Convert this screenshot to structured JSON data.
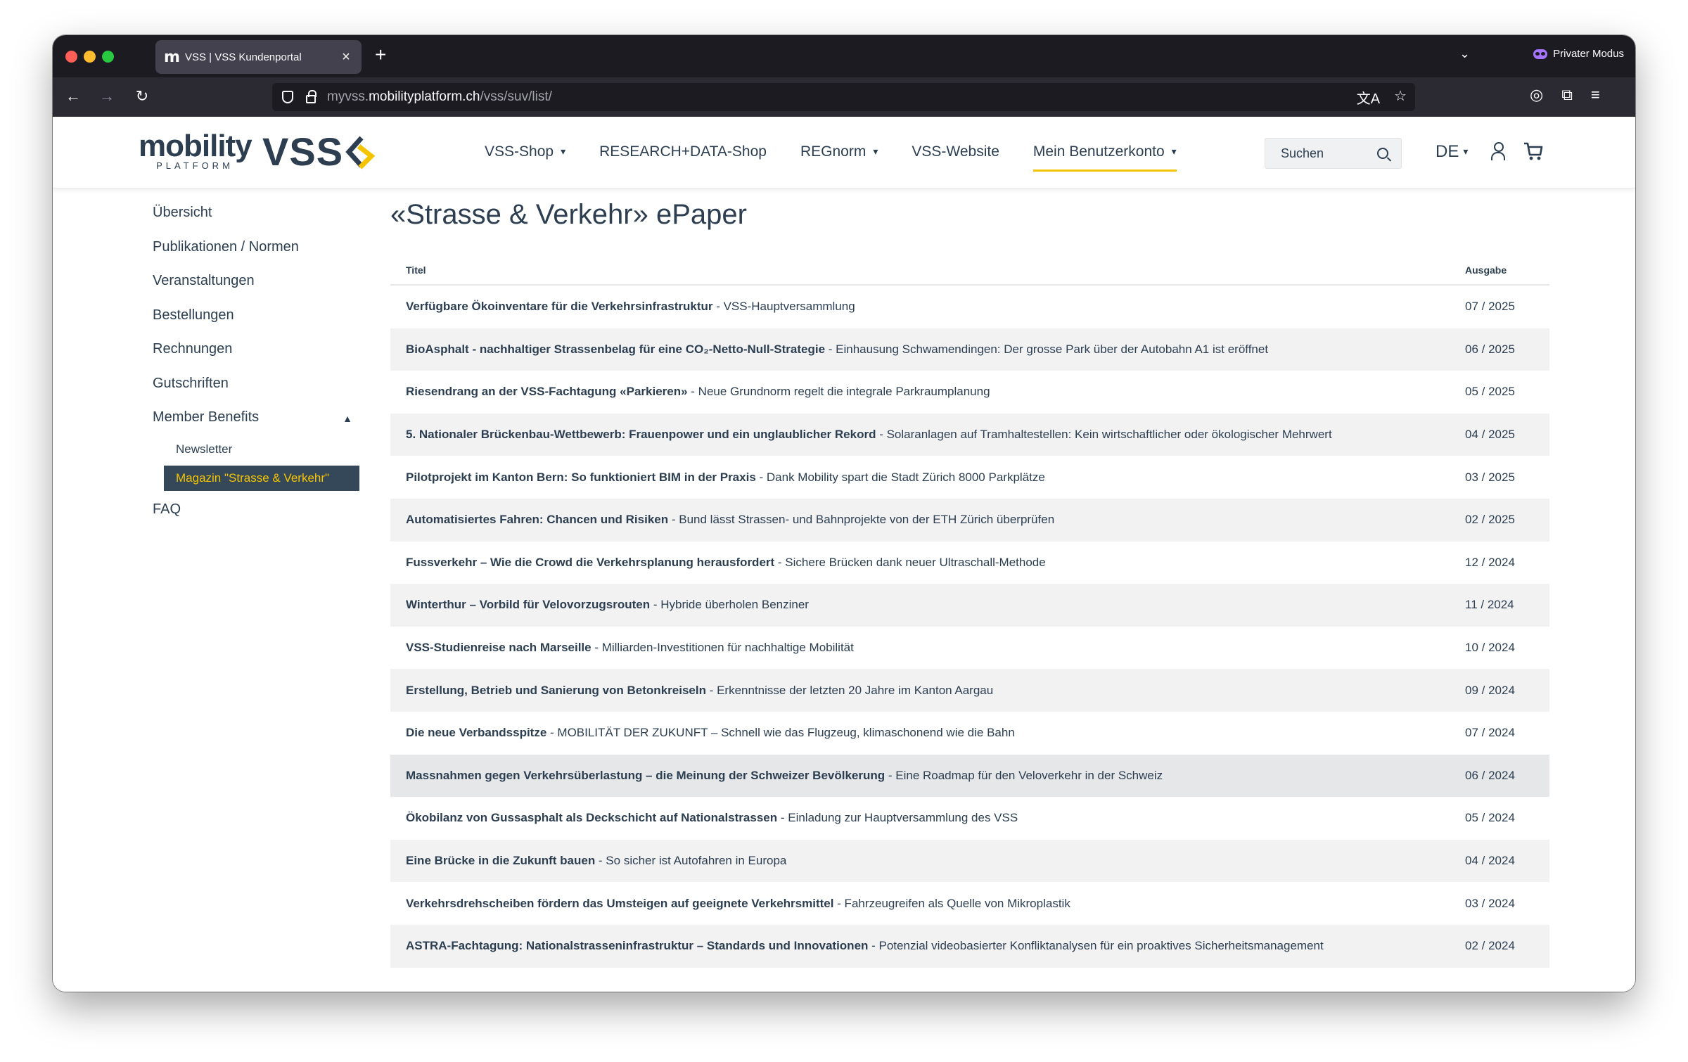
{
  "browser": {
    "tab_favicon": "m",
    "tab_title": "VSS | VSS Kundenportal",
    "tab_close": "×",
    "new_tab": "+",
    "tab_list": "⌄",
    "private_label": "Privater Modus",
    "back": "←",
    "forward": "→",
    "reload": "↻",
    "url_prefix": "myvss.",
    "url_host": "mobilityplatform.ch",
    "url_path": "/vss/suv/list/",
    "translate_icon": "文A",
    "bookmark_icon": "☆",
    "toolbar_icons": [
      "◎",
      "⧉",
      "≡"
    ]
  },
  "header": {
    "logo_mobility_word": "mobility",
    "logo_mobility_sub": "PLATFORM",
    "logo_vss_word": "VSS",
    "nav": [
      {
        "label": "VSS-Shop",
        "dropdown": true
      },
      {
        "label": "RESEARCH+DATA-Shop",
        "dropdown": false
      },
      {
        "label": "REGnorm",
        "dropdown": true
      },
      {
        "label": "VSS-Website",
        "dropdown": false
      },
      {
        "label": "Mein Benutzerkonto",
        "dropdown": true,
        "active": true
      }
    ],
    "search_placeholder": "Suchen",
    "language": "DE",
    "accent_color": "#f5c400"
  },
  "sidebar": {
    "items": [
      {
        "label": "Übersicht"
      },
      {
        "label": "Publikationen / Normen"
      },
      {
        "label": "Veranstaltungen"
      },
      {
        "label": "Bestellungen"
      },
      {
        "label": "Rechnungen"
      },
      {
        "label": "Gutschriften"
      },
      {
        "label": "Member Benefits"
      }
    ],
    "subitems": [
      {
        "label": "Newsletter"
      },
      {
        "label": "Magazin \"Strasse & Verkehr\""
      }
    ],
    "faq_label": "FAQ"
  },
  "main": {
    "title": "«Strasse & Verkehr» ePaper",
    "columns": {
      "title": "Titel",
      "issue": "Ausgabe"
    },
    "rows": [
      {
        "bold": "Verfügbare Ökoinventare für die Verkehrsinfrastruktur",
        "rest": " - VSS-Hauptversammlung",
        "issue": "07 / 2025"
      },
      {
        "bold": "BioAsphalt - nachhaltiger Strassenbelag für eine CO₂-Netto-Null-Strategie",
        "rest": " - Einhausung Schwamendingen: Der grosse Park über der Autobahn A1 ist eröffnet",
        "issue": "06 / 2025"
      },
      {
        "bold": "Riesendrang an der VSS-Fachtagung «Parkieren»",
        "rest": " - Neue Grundnorm regelt die integrale Parkraumplanung",
        "issue": "05 / 2025"
      },
      {
        "bold": "5. Nationaler Brückenbau-Wettbewerb: Frauenpower und ein unglaublicher Rekord",
        "rest": " - Solaranlagen auf Tramhaltestellen: Kein wirtschaftlicher oder ökologischer Mehrwert",
        "issue": "04 / 2025"
      },
      {
        "bold": "Pilotprojekt im Kanton Bern: So funktioniert BIM in der Praxis",
        "rest": " - Dank Mobility spart die Stadt Zürich 8000 Parkplätze",
        "issue": "03 / 2025"
      },
      {
        "bold": "Automatisiertes Fahren: Chancen und Risiken",
        "rest": " - Bund lässt Strassen- und Bahnprojekte von der ETH Zürich überprüfen",
        "issue": "02 / 2025"
      },
      {
        "bold": "Fussverkehr – Wie die Crowd die Verkehrsplanung herausfordert",
        "rest": " - Sichere Brücken dank neuer Ultraschall-Methode",
        "issue": "12 / 2024"
      },
      {
        "bold": "Winterthur – Vorbild für Velovorzugsrouten",
        "rest": " - Hybride überholen Benziner",
        "issue": "11 / 2024"
      },
      {
        "bold": "VSS-Studienreise nach Marseille",
        "rest": " - Milliarden-Investitionen für nachhaltige Mobilität",
        "issue": "10 / 2024"
      },
      {
        "bold": "Erstellung, Betrieb und Sanierung von Betonkreiseln",
        "rest": " - Erkenntnisse der letzten 20 Jahre im Kanton Aargau",
        "issue": "09 / 2024"
      },
      {
        "bold": "Die neue Verbandsspitze",
        "rest": " - MOBILITÄT DER ZUKUNFT – Schnell wie das Flugzeug, klimaschonend wie die Bahn",
        "issue": "07 / 2024"
      },
      {
        "bold": "Massnahmen gegen Verkehrsüberlastung – die Meinung der Schweizer Bevölkerung",
        "rest": " - Eine Roadmap für den Veloverkehr in der Schweiz",
        "issue": "06 / 2024"
      },
      {
        "bold": "Ökobilanz von Gussasphalt als Deckschicht auf Nationalstrassen",
        "rest": " - Einladung zur Hauptversammlung des VSS",
        "issue": "05 / 2024"
      },
      {
        "bold": "Eine Brücke in die Zukunft bauen",
        "rest": " - So sicher ist Autofahren in Europa",
        "issue": "04 / 2024"
      },
      {
        "bold": "Verkehrsdrehscheiben fördern das Umsteigen auf geeignete Verkehrsmittel",
        "rest": " - Fahrzeugreifen als Quelle von Mikroplastik",
        "issue": "03 / 2024"
      },
      {
        "bold": "ASTRA-Fachtagung: Nationalstrasseninfrastruktur – Standards und Innovationen",
        "rest": " - Potenzial videobasierter Konfliktanalysen für ein proaktives Sicherheitsmanagement",
        "issue": "02 / 2024"
      }
    ]
  }
}
